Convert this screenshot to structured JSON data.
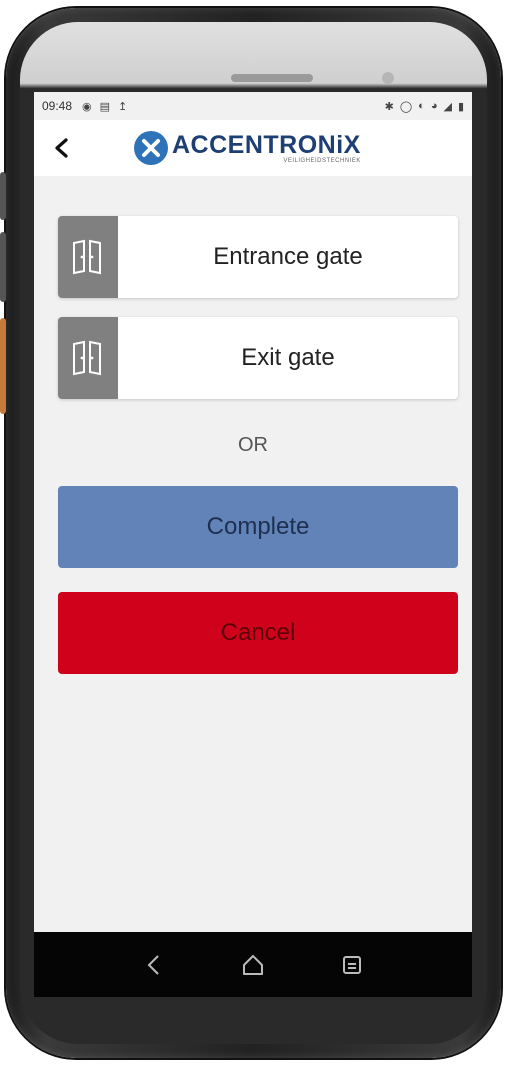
{
  "status_bar": {
    "time": "09:48",
    "left_icons": [
      "photo-icon",
      "message-icon",
      "upload-icon"
    ],
    "right_icons": [
      "bluetooth-icon",
      "location-icon",
      "vibrate-icon",
      "wifi-icon",
      "signal-icon",
      "battery-icon"
    ]
  },
  "app_bar": {
    "logo_text": "ACCENTRONiX",
    "logo_subtitle": "VEILIGHEIDSTECHNIEK"
  },
  "gates": [
    {
      "label": "Entrance gate"
    },
    {
      "label": "Exit gate"
    }
  ],
  "separator": "OR",
  "actions": {
    "complete_label": "Complete",
    "cancel_label": "Cancel"
  },
  "colors": {
    "complete_bg": "#6183b8",
    "cancel_bg": "#d0021b",
    "gate_icon_bg": "#808080",
    "screen_bg": "#f1f1f1",
    "brand": "#1d3f73"
  }
}
